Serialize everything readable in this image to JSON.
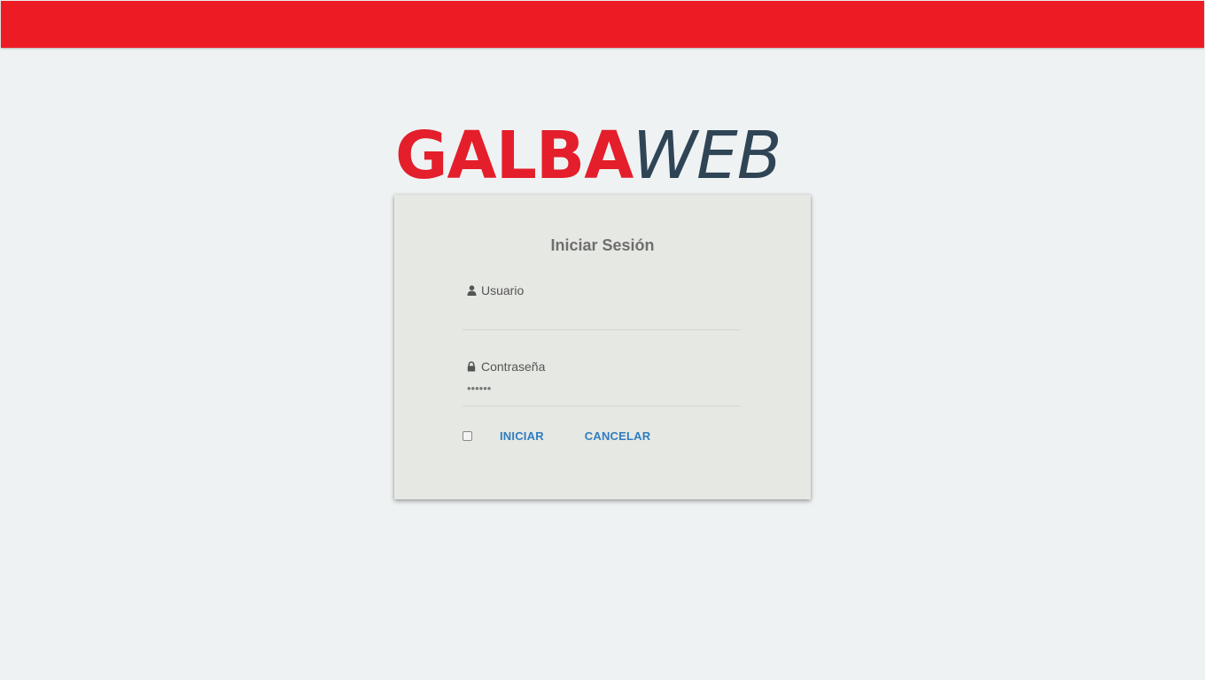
{
  "brand": {
    "logo_part1": "GALBA",
    "logo_part2": "WEB",
    "primary_color": "#ed1c24",
    "secondary_color": "#2f4556"
  },
  "login": {
    "title": "Iniciar Sesión",
    "username": {
      "label": "Usuario",
      "icon": "user-icon",
      "value": ""
    },
    "password": {
      "label": "Contraseña",
      "icon": "lock-icon",
      "value": "••••••"
    },
    "remember_checked": false,
    "submit_label": "INICIAR",
    "cancel_label": "CANCELAR",
    "link_color": "#2f7dc1"
  }
}
